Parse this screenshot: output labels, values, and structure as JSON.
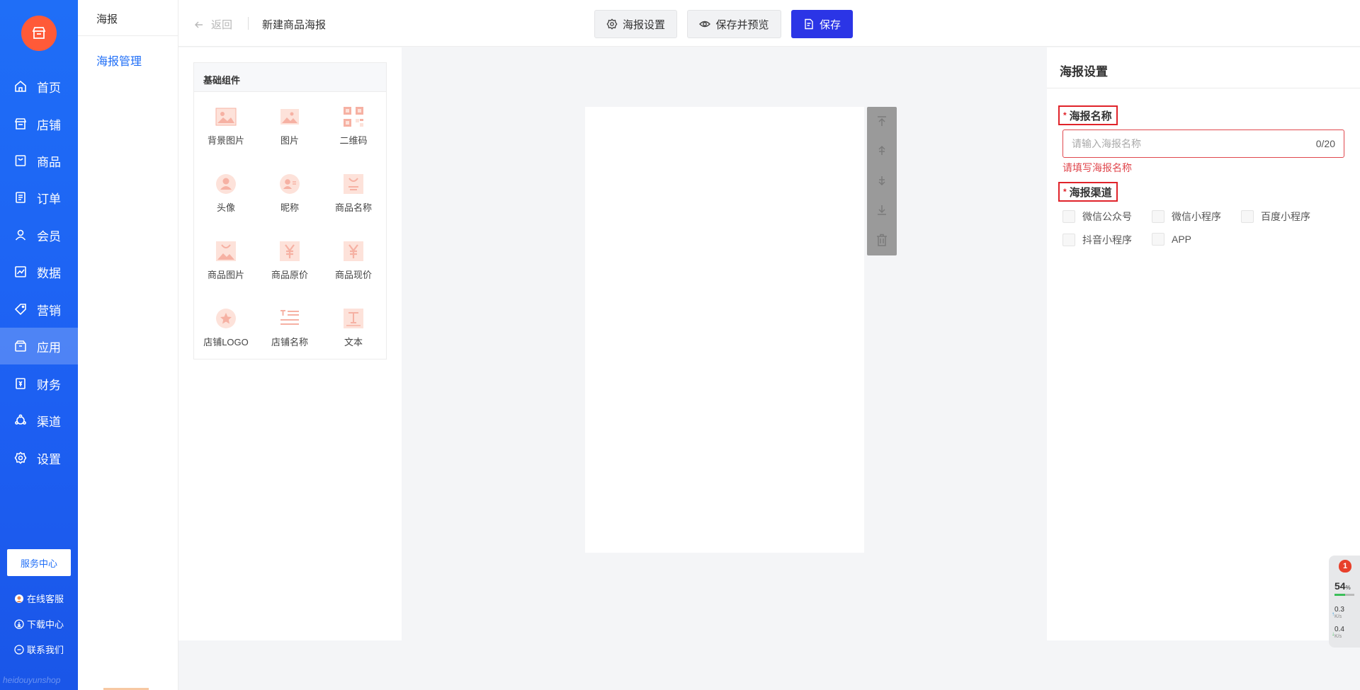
{
  "nav": {
    "items": [
      {
        "label": "首页",
        "icon": "home-icon"
      },
      {
        "label": "店铺",
        "icon": "store-icon"
      },
      {
        "label": "商品",
        "icon": "goods-icon"
      },
      {
        "label": "订单",
        "icon": "order-icon"
      },
      {
        "label": "会员",
        "icon": "member-icon"
      },
      {
        "label": "数据",
        "icon": "chart-icon"
      },
      {
        "label": "营销",
        "icon": "tag-icon"
      },
      {
        "label": "应用",
        "icon": "app-icon"
      },
      {
        "label": "财务",
        "icon": "finance-icon"
      },
      {
        "label": "渠道",
        "icon": "channel-icon"
      },
      {
        "label": "设置",
        "icon": "gear-icon"
      }
    ],
    "active_index": 7,
    "service_center": "服务中心",
    "links": [
      "在线客服",
      "下载中心",
      "联系我们"
    ],
    "watermark": "heidouyunshop"
  },
  "subnav": {
    "title": "海报",
    "item": "海报管理"
  },
  "topbar": {
    "back": "返回",
    "crumb": "新建商品海报",
    "btn_settings": "海报设置",
    "btn_preview": "保存并预览",
    "btn_save": "保存"
  },
  "components": {
    "title": "基础组件",
    "items": [
      "背景图片",
      "图片",
      "二维码",
      "头像",
      "昵称",
      "商品名称",
      "商品图片",
      "商品原价",
      "商品现价",
      "店铺LOGO",
      "店铺名称",
      "文本"
    ]
  },
  "settings": {
    "title": "海报设置",
    "name_label": "海报名称",
    "name_placeholder": "请输入海报名称",
    "name_value": "",
    "name_count": "0/20",
    "name_error": "请填写海报名称",
    "channel_label": "海报渠道",
    "channels": [
      "微信公众号",
      "微信小程序",
      "百度小程序",
      "抖音小程序",
      "APP"
    ]
  },
  "widget": {
    "badge": "1",
    "percent": "54",
    "percent_unit": "%",
    "percent_value": 54,
    "up": "0.3",
    "down": "0.4",
    "unit": "K/s"
  },
  "colors": {
    "primary": "#1f6ef7",
    "save": "#2b35e6",
    "accent": "#ff5a38",
    "error": "#e0232a",
    "component_icon": "#f6b1a3"
  }
}
